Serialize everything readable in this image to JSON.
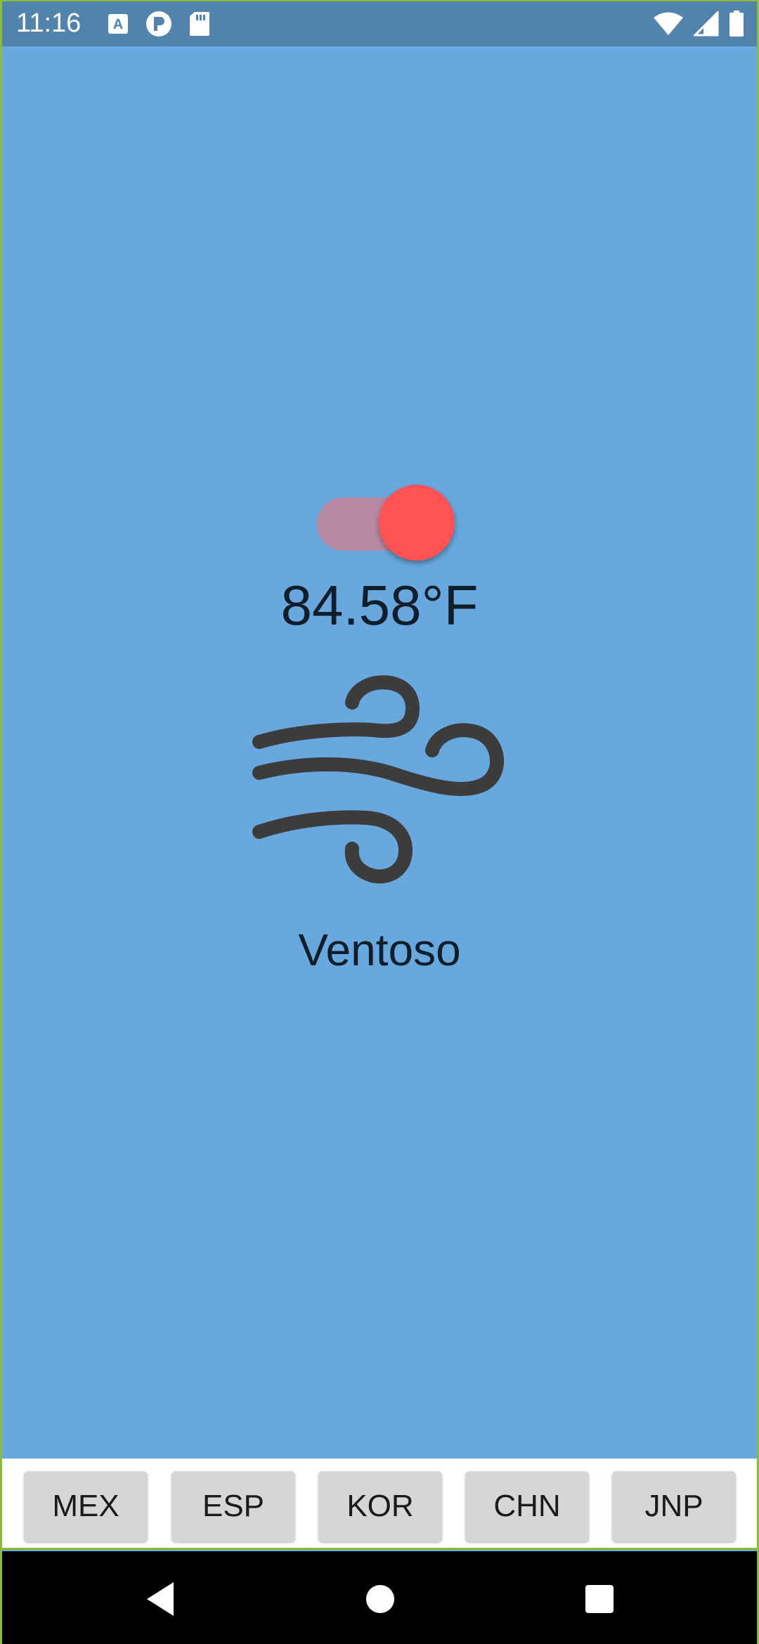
{
  "status_bar": {
    "time": "11:16",
    "left_icons": [
      "font-a-icon",
      "circle-p-icon",
      "sd-card-icon"
    ],
    "right_icons": [
      "wifi-icon",
      "cellular-signal-icon",
      "battery-icon"
    ]
  },
  "toggle": {
    "state": "on",
    "thumb_color": "#ff5255",
    "track_color": "#b88aa3"
  },
  "weather": {
    "temperature": "84.58°F",
    "condition_icon": "wind-icon",
    "condition": "Ventoso"
  },
  "colors": {
    "background": "#68a8de",
    "status_bar": "#5183ad"
  },
  "countries": [
    {
      "label": "MEX"
    },
    {
      "label": "ESP"
    },
    {
      "label": "KOR"
    },
    {
      "label": "CHN"
    },
    {
      "label": "JNP"
    }
  ],
  "nav_bar": {
    "icons": [
      "back-icon",
      "home-icon",
      "recents-icon"
    ]
  }
}
